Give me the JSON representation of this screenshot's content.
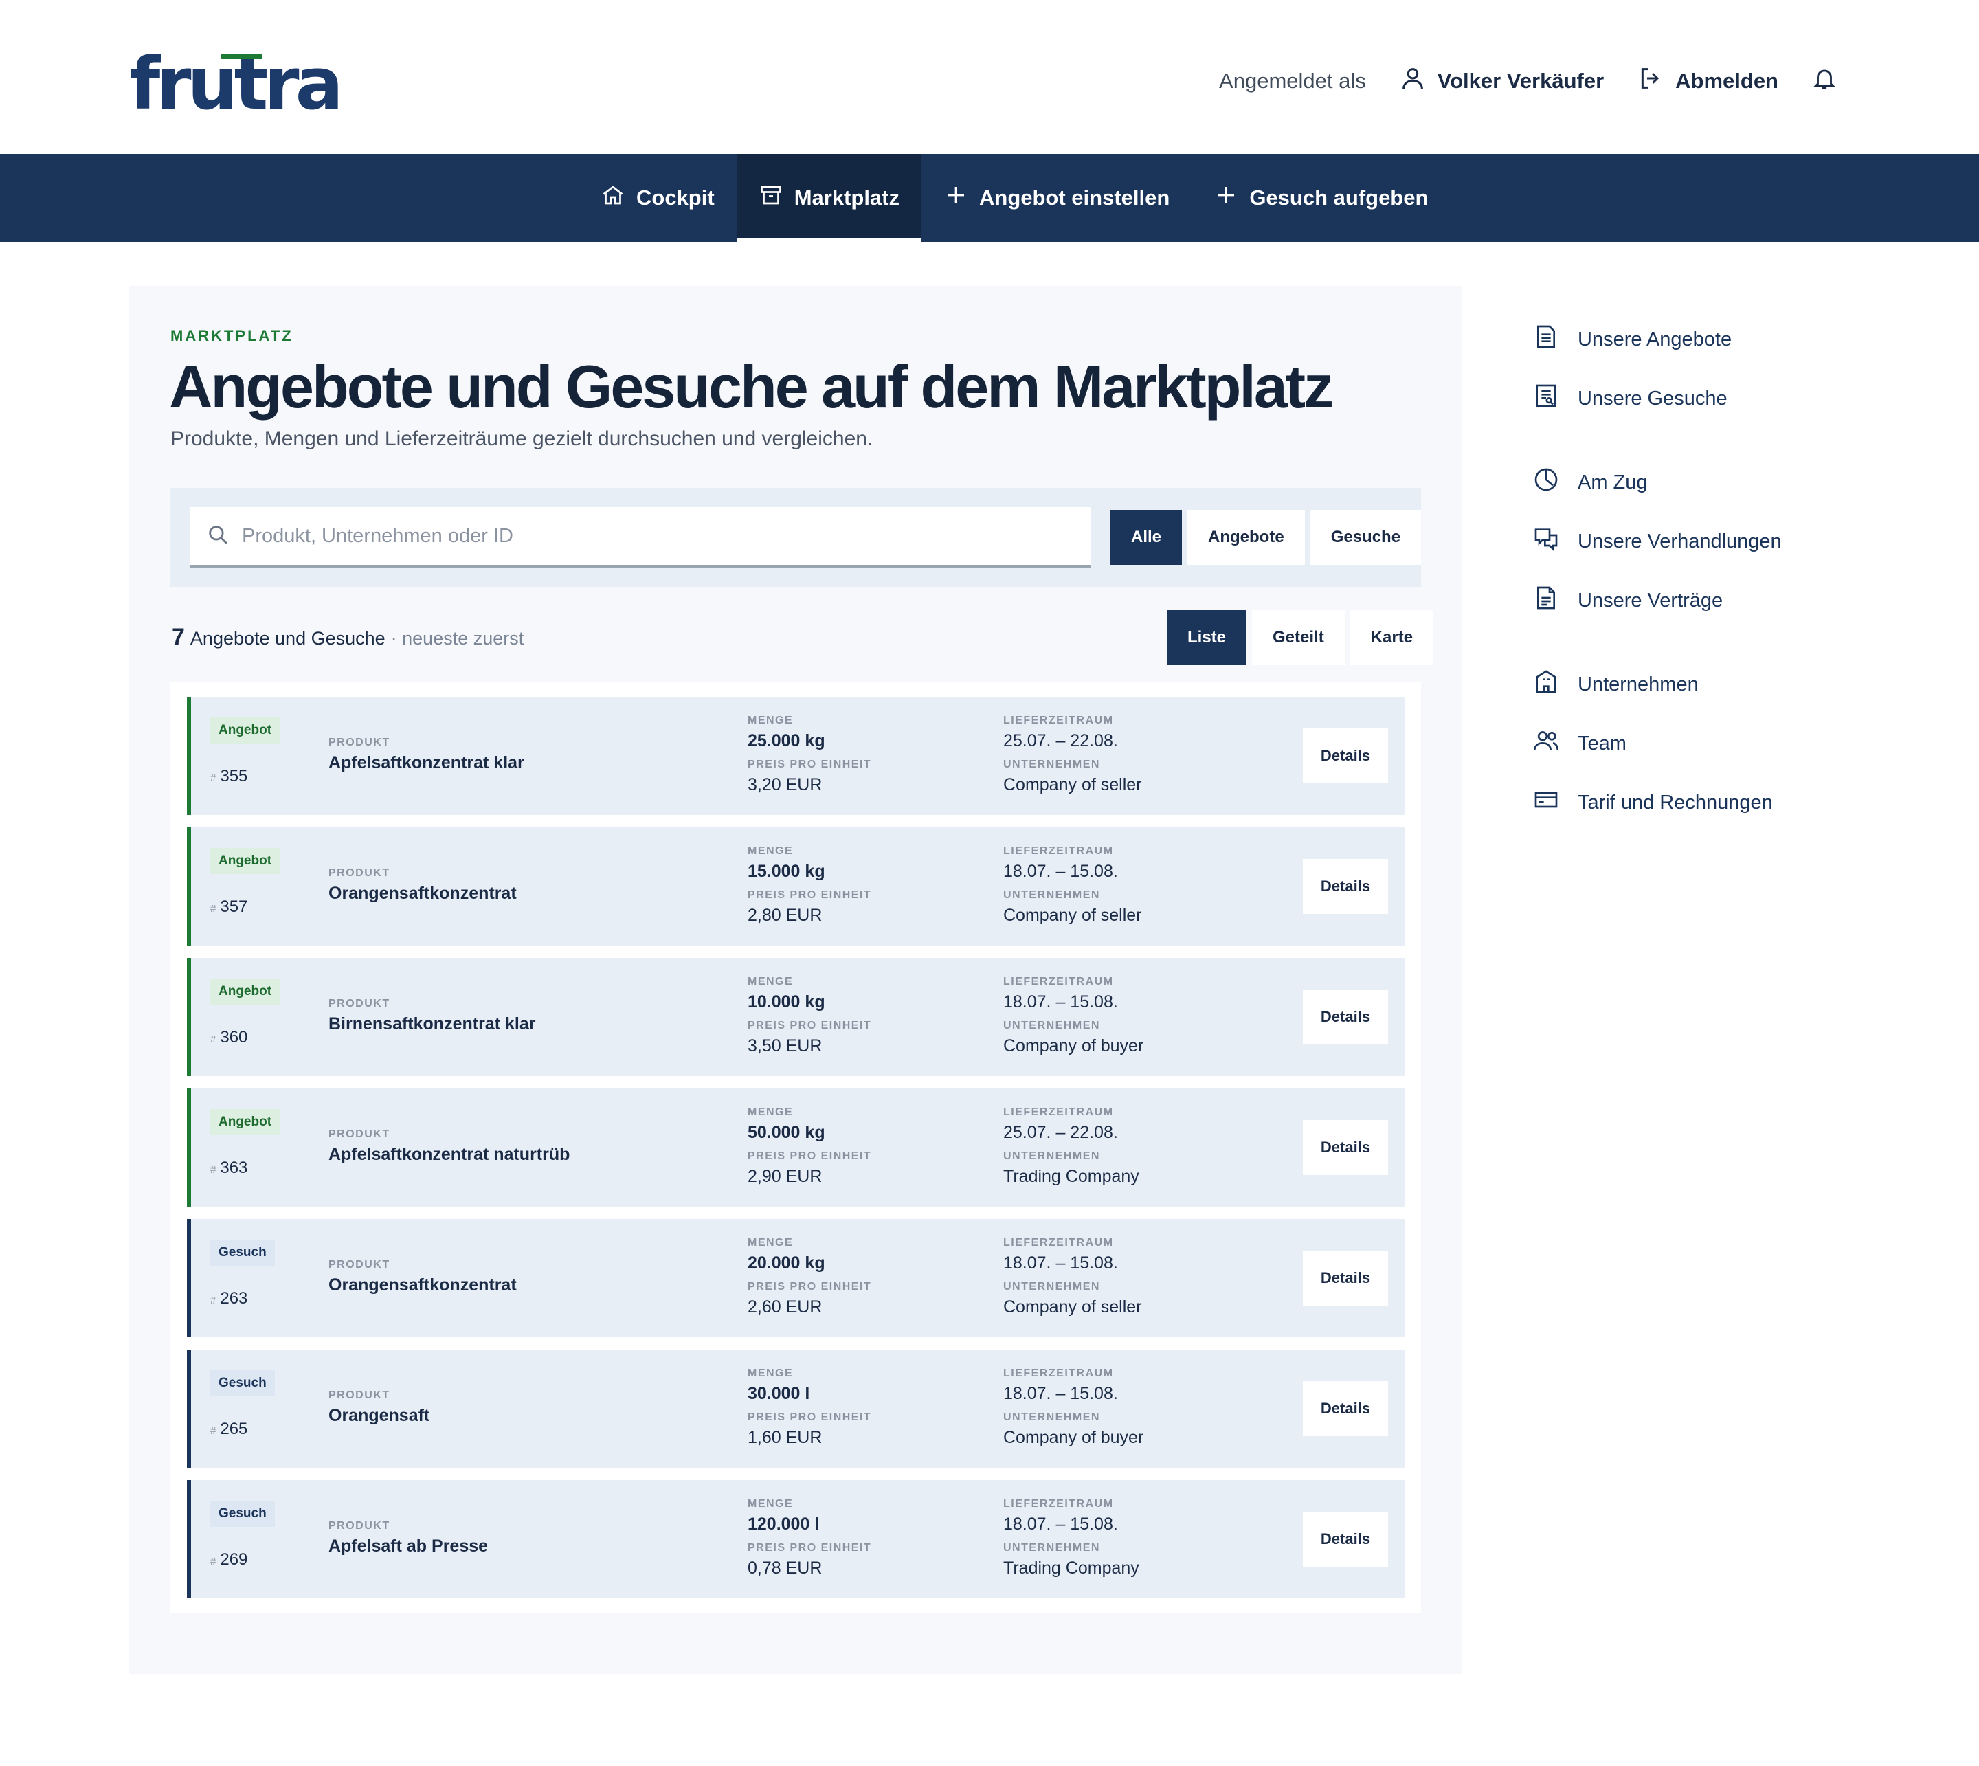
{
  "header": {
    "logo": "frutra",
    "logged_in_label": "Angemeldet als",
    "user_name": "Volker Verkäufer",
    "logout_label": "Abmelden"
  },
  "nav": {
    "cockpit": "Cockpit",
    "marktplatz": "Marktplatz",
    "angebot_einstellen": "Angebot einstellen",
    "gesuch_aufgeben": "Gesuch aufgeben",
    "active": "Marktplatz"
  },
  "main": {
    "eyebrow": "MARKTPLATZ",
    "title": "Angebote und Gesuche auf dem Marktplatz",
    "subtitle": "Produkte, Mengen und Lieferzeiträume gezielt durchsuchen und vergleichen.",
    "search_placeholder": "Produkt, Unternehmen oder ID",
    "type_filters": [
      "Alle",
      "Angebote",
      "Gesuche"
    ],
    "type_selected": "Alle",
    "count": "7",
    "count_label": "Angebote und Gesuche",
    "sort_label": "· neueste zuerst",
    "view_modes": [
      "Liste",
      "Geteilt",
      "Karte"
    ],
    "view_selected": "Liste"
  },
  "captions": {
    "produkt": "PRODUKT",
    "menge": "MENGE",
    "preis": "PREIS PRO EINHEIT",
    "lieferzeitraum": "LIEFERZEITRAUM",
    "unternehmen": "UNTERNEHMEN",
    "details": "Details",
    "hash": "#"
  },
  "listings": [
    {
      "type": "Angebot",
      "id": "355",
      "product": "Apfelsaftkonzentrat klar",
      "quantity": "25.000 kg",
      "price": "3,20 EUR",
      "period": "25.07. – 22.08.",
      "company": "Company of seller"
    },
    {
      "type": "Angebot",
      "id": "357",
      "product": "Orangensaftkonzentrat",
      "quantity": "15.000 kg",
      "price": "2,80 EUR",
      "period": "18.07. – 15.08.",
      "company": "Company of seller"
    },
    {
      "type": "Angebot",
      "id": "360",
      "product": "Birnensaftkonzentrat klar",
      "quantity": "10.000 kg",
      "price": "3,50 EUR",
      "period": "18.07. – 15.08.",
      "company": "Company of buyer"
    },
    {
      "type": "Angebot",
      "id": "363",
      "product": "Apfelsaftkonzentrat naturtrüb",
      "quantity": "50.000 kg",
      "price": "2,90 EUR",
      "period": "25.07. – 22.08.",
      "company": "Trading Company"
    },
    {
      "type": "Gesuch",
      "id": "263",
      "product": "Orangensaftkonzentrat",
      "quantity": "20.000 kg",
      "price": "2,60 EUR",
      "period": "18.07. – 15.08.",
      "company": "Company of seller"
    },
    {
      "type": "Gesuch",
      "id": "265",
      "product": "Orangensaft",
      "quantity": "30.000 l",
      "price": "1,60 EUR",
      "period": "18.07. – 15.08.",
      "company": "Company of buyer"
    },
    {
      "type": "Gesuch",
      "id": "269",
      "product": "Apfelsaft ab Presse",
      "quantity": "120.000 l",
      "price": "0,78 EUR",
      "period": "18.07. – 15.08.",
      "company": "Trading Company"
    }
  ],
  "sidebar": {
    "items": [
      {
        "label": "Unsere Angebote",
        "icon": "document-icon"
      },
      {
        "label": "Unsere Gesuche",
        "icon": "search-document-icon"
      },
      {
        "label": "Am Zug",
        "icon": "clock-icon"
      },
      {
        "label": "Unsere Verhandlungen",
        "icon": "chat-icon"
      },
      {
        "label": "Unsere Verträge",
        "icon": "contract-icon"
      },
      {
        "label": "Unternehmen",
        "icon": "building-icon"
      },
      {
        "label": "Team",
        "icon": "team-icon"
      },
      {
        "label": "Tarif und Rechnungen",
        "icon": "credit-card-icon"
      }
    ]
  },
  "colors": {
    "brand_navy": "#1b345a",
    "nav_active": "#132743",
    "accent_green": "#1d7a34",
    "row_bg": "#e8eef6"
  }
}
